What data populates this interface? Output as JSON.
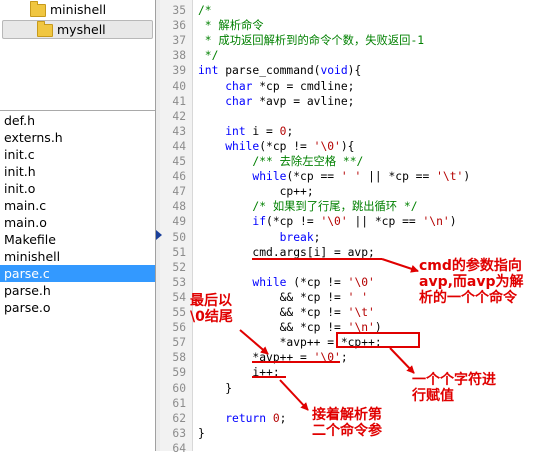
{
  "folders": [
    {
      "label": "minishell",
      "selected": false
    },
    {
      "label": "myshell",
      "selected": true
    }
  ],
  "files": [
    {
      "label": "def.h",
      "selected": false
    },
    {
      "label": "externs.h",
      "selected": false
    },
    {
      "label": "init.c",
      "selected": false
    },
    {
      "label": "init.h",
      "selected": false
    },
    {
      "label": "init.o",
      "selected": false
    },
    {
      "label": "main.c",
      "selected": false
    },
    {
      "label": "main.o",
      "selected": false
    },
    {
      "label": "Makefile",
      "selected": false
    },
    {
      "label": "minishell",
      "selected": false
    },
    {
      "label": "parse.c",
      "selected": true
    },
    {
      "label": "parse.h",
      "selected": false
    },
    {
      "label": "parse.o",
      "selected": false
    }
  ],
  "code": [
    {
      "n": "35",
      "tokens": [
        [
          "cm",
          "/*"
        ]
      ]
    },
    {
      "n": "36",
      "tokens": [
        [
          "cm",
          " * 解析命令"
        ]
      ]
    },
    {
      "n": "37",
      "tokens": [
        [
          "cm",
          " * 成功返回解析到的命令个数，失败返回-1"
        ]
      ]
    },
    {
      "n": "38",
      "tokens": [
        [
          "cm",
          " */"
        ]
      ]
    },
    {
      "n": "39",
      "tokens": [
        [
          "kw",
          "int"
        ],
        [
          "",
          " parse_command("
        ],
        [
          "kw",
          "void"
        ],
        [
          "",
          "){"
        ]
      ]
    },
    {
      "n": "40",
      "tokens": [
        [
          "",
          "    "
        ],
        [
          "kw",
          "char"
        ],
        [
          "",
          " *cp = cmdline;"
        ]
      ]
    },
    {
      "n": "41",
      "tokens": [
        [
          "",
          "    "
        ],
        [
          "kw",
          "char"
        ],
        [
          "",
          " *avp = avline;"
        ]
      ]
    },
    {
      "n": "42",
      "tokens": []
    },
    {
      "n": "43",
      "tokens": [
        [
          "",
          "    "
        ],
        [
          "kw",
          "int"
        ],
        [
          "",
          " i = "
        ],
        [
          "nu",
          "0"
        ],
        [
          "",
          ";"
        ]
      ]
    },
    {
      "n": "44",
      "tokens": [
        [
          "",
          "    "
        ],
        [
          "kw",
          "while"
        ],
        [
          "",
          "(*cp != "
        ],
        [
          "st",
          "'\\0'"
        ],
        [
          "",
          "){"
        ]
      ]
    },
    {
      "n": "45",
      "tokens": [
        [
          "",
          "        "
        ],
        [
          "cm",
          "/** 去除左空格 **/"
        ]
      ]
    },
    {
      "n": "46",
      "tokens": [
        [
          "",
          "        "
        ],
        [
          "kw",
          "while"
        ],
        [
          "",
          "(*cp == "
        ],
        [
          "st",
          "' '"
        ],
        [
          "",
          " || *cp == "
        ],
        [
          "st",
          "'\\t'"
        ],
        [
          "",
          ")"
        ]
      ]
    },
    {
      "n": "47",
      "tokens": [
        [
          "",
          "            cp++;"
        ]
      ]
    },
    {
      "n": "48",
      "tokens": [
        [
          "",
          "        "
        ],
        [
          "cm",
          "/* 如果到了行尾，跳出循环 */"
        ]
      ]
    },
    {
      "n": "49",
      "tokens": [
        [
          "",
          "        "
        ],
        [
          "kw",
          "if"
        ],
        [
          "",
          "(*cp != "
        ],
        [
          "st",
          "'\\0'"
        ],
        [
          "",
          " || *cp == "
        ],
        [
          "st",
          "'\\n'"
        ],
        [
          "",
          ")"
        ]
      ]
    },
    {
      "n": "50",
      "tokens": [
        [
          "",
          "            "
        ],
        [
          "kw",
          "break"
        ],
        [
          "",
          ";"
        ]
      ]
    },
    {
      "n": "51",
      "tokens": [
        [
          "",
          "        cmd.args[i] = avp;"
        ]
      ]
    },
    {
      "n": "52",
      "tokens": []
    },
    {
      "n": "53",
      "tokens": [
        [
          "",
          "        "
        ],
        [
          "kw",
          "while"
        ],
        [
          "",
          " (*cp != "
        ],
        [
          "st",
          "'\\0'"
        ]
      ]
    },
    {
      "n": "54",
      "tokens": [
        [
          "",
          "            && *cp != "
        ],
        [
          "st",
          "' '"
        ]
      ]
    },
    {
      "n": "55",
      "tokens": [
        [
          "",
          "            && *cp != "
        ],
        [
          "st",
          "'\\t'"
        ]
      ]
    },
    {
      "n": "56",
      "tokens": [
        [
          "",
          "            && *cp != "
        ],
        [
          "st",
          "'\\n'"
        ],
        [
          "",
          ")"
        ]
      ]
    },
    {
      "n": "57",
      "tokens": [
        [
          "",
          "            *avp++ = *cp++;"
        ]
      ]
    },
    {
      "n": "58",
      "tokens": [
        [
          "",
          "        *avp++ = "
        ],
        [
          "st",
          "'\\0'"
        ],
        [
          "",
          ";"
        ]
      ]
    },
    {
      "n": "59",
      "tokens": [
        [
          "",
          "        i++;"
        ]
      ]
    },
    {
      "n": "60",
      "tokens": [
        [
          "",
          "    }"
        ]
      ]
    },
    {
      "n": "61",
      "tokens": []
    },
    {
      "n": "62",
      "tokens": [
        [
          "",
          "    "
        ],
        [
          "kw",
          "return"
        ],
        [
          "",
          " "
        ],
        [
          "nu",
          "0"
        ],
        [
          "",
          ";"
        ]
      ]
    },
    {
      "n": "63",
      "tokens": [
        [
          "",
          "}"
        ]
      ]
    },
    {
      "n": "64",
      "tokens": []
    }
  ],
  "annotations": {
    "cmd_args": "cmd的参数指向\navp,而avp为解\n析的一个个命令",
    "end_with_zero": "最后以\n\\0结尾",
    "char_assign": "一个个字符进\n行赋值",
    "next_command": "接着解析第\n二个命令参"
  },
  "colors": {
    "annotation": "#e00000",
    "keyword": "#0000ff",
    "comment": "#008000",
    "string": "#b40000",
    "selection": "#3399ff"
  }
}
